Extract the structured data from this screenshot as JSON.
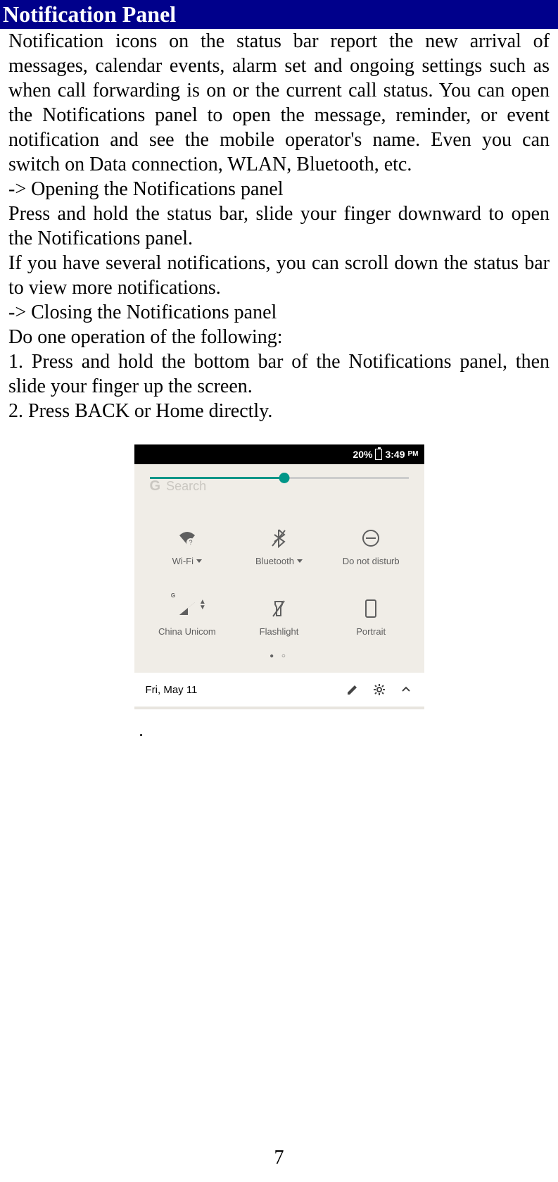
{
  "header": {
    "title": "Notification Panel"
  },
  "text": {
    "intro1": "Notification icons on the status bar report the new arrival of messages, calendar events, alarm set and ongoing settings such as when call forwarding is on or the current call status. You can open the Notifications panel to open the message, reminder, or event notification and see the mobile operator's name. Even you can switch on Data connection, WLAN, Bluetooth, etc.",
    "sub1": "-> Opening the Notifications panel",
    "p1": "Press and hold the status bar, slide your finger downward to open the Notifications panel.",
    "p2": "If you have several notifications, you can scroll down the status bar to view more notifications.",
    "sub2": "-> Closing the Notifications panel",
    "p3": "Do one operation of the following:",
    "p4": "1. Press and hold the bottom bar of the Notifications panel, then slide your finger up the screen.",
    "p5": "2. Press BACK or Home directly."
  },
  "phone": {
    "status": {
      "battery_pct": "20%",
      "time": "3:49",
      "ampm": "PM"
    },
    "search_placeholder": "Search",
    "tiles": [
      {
        "label": "Wi-Fi",
        "has_caret": true
      },
      {
        "label": "Bluetooth",
        "has_caret": true
      },
      {
        "label": "Do not disturb",
        "has_caret": false
      },
      {
        "label": "China Unicom",
        "has_caret": false
      },
      {
        "label": "Flashlight",
        "has_caret": false
      },
      {
        "label": "Portrait",
        "has_caret": false
      }
    ],
    "date": "Fri, May 11"
  },
  "page_number": "7"
}
